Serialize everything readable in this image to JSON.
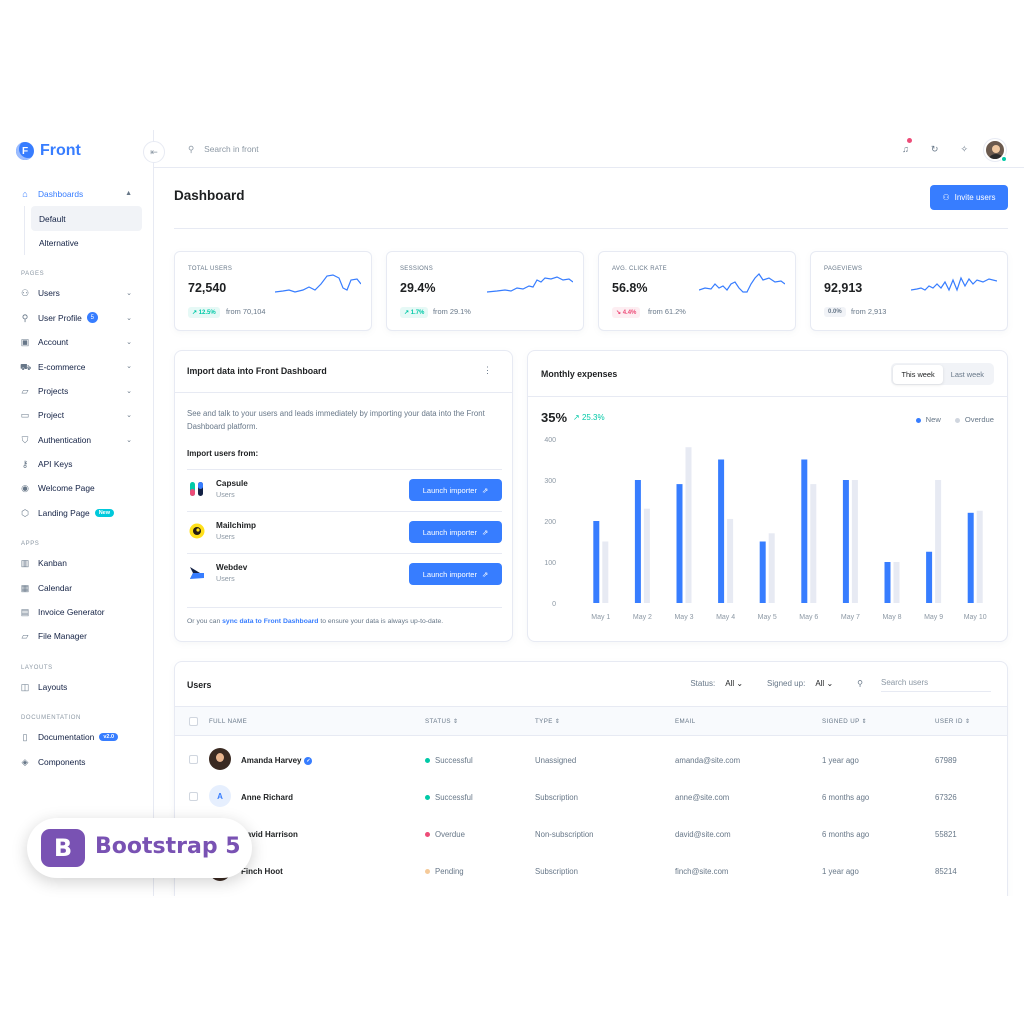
{
  "app": {
    "name": "Front",
    "logo_letter": "F",
    "brand_color": "#377dff"
  },
  "topbar": {
    "search_placeholder": "Search in front"
  },
  "sidebar": {
    "dashboards": {
      "label": "Dashboards",
      "children": [
        "Default",
        "Alternative"
      ]
    },
    "pages_heading": "PAGES",
    "pages": [
      {
        "label": "Users"
      },
      {
        "label": "User Profile",
        "badge": "5"
      },
      {
        "label": "Account"
      },
      {
        "label": "E-commerce"
      },
      {
        "label": "Projects"
      },
      {
        "label": "Project"
      },
      {
        "label": "Authentication"
      },
      {
        "label": "API Keys"
      },
      {
        "label": "Welcome Page"
      },
      {
        "label": "Landing Page",
        "badge": "New"
      }
    ],
    "apps_heading": "APPS",
    "apps": [
      "Kanban",
      "Calendar",
      "Invoice Generator",
      "File Manager"
    ],
    "layouts_heading": "LAYOUTS",
    "layouts": [
      "Layouts"
    ],
    "docs_heading": "DOCUMENTATION",
    "docs": [
      {
        "label": "Documentation",
        "badge": "v2.0"
      },
      {
        "label": "Components"
      }
    ]
  },
  "page": {
    "title": "Dashboard",
    "invite_label": "Invite users"
  },
  "stats": [
    {
      "label": "TOTAL USERS",
      "value": "72,540",
      "change": "12.5%",
      "trend": "up",
      "from": "from 70,104"
    },
    {
      "label": "SESSIONS",
      "value": "29.4%",
      "change": "1.7%",
      "trend": "up",
      "from": "from 29.1%"
    },
    {
      "label": "AVG. CLICK RATE",
      "value": "56.8%",
      "change": "4.4%",
      "trend": "down",
      "from": "from 61.2%"
    },
    {
      "label": "PAGEVIEWS",
      "value": "92,913",
      "change": "0.0%",
      "trend": "flat",
      "from": "from 2,913"
    }
  ],
  "import_card": {
    "title": "Import data into Front Dashboard",
    "description": "See and talk to your users and leads immediately by importing your data into the Front Dashboard platform.",
    "from_heading": "Import users from:",
    "button_label": "Launch importer",
    "sources": [
      {
        "name": "Capsule",
        "sub": "Users"
      },
      {
        "name": "Mailchimp",
        "sub": "Users"
      },
      {
        "name": "Webdev",
        "sub": "Users"
      }
    ],
    "footer_pre": "Or you can ",
    "footer_link": "sync data to Front Dashboard",
    "footer_post": " to ensure your data is always up-to-date."
  },
  "expenses": {
    "title": "Monthly expenses",
    "tab_this": "This week",
    "tab_last": "Last week",
    "big_value": "35%",
    "growth": "25.3%"
  },
  "chart_data": {
    "type": "bar",
    "categories": [
      "May 1",
      "May 2",
      "May 3",
      "May 4",
      "May 5",
      "May 6",
      "May 7",
      "May 8",
      "May 9",
      "May 10"
    ],
    "series": [
      {
        "name": "New",
        "color": "#377dff",
        "values": [
          200,
          300,
          290,
          350,
          150,
          350,
          300,
          100,
          125,
          220
        ]
      },
      {
        "name": "Overdue",
        "color": "#e7eaf3",
        "values": [
          150,
          230,
          380,
          205,
          170,
          290,
          300,
          100,
          300,
          225
        ]
      }
    ],
    "ylim": [
      0,
      400
    ],
    "yticks": [
      "400",
      "300",
      "200",
      "100",
      "0"
    ],
    "grid": false,
    "legend_position": "top-right"
  },
  "users_table": {
    "title": "Users",
    "status_label": "Status:",
    "status_value": "All",
    "signed_label": "Signed up:",
    "signed_value": "All",
    "search_placeholder": "Search users",
    "columns": [
      "FULL NAME",
      "STATUS",
      "TYPE",
      "EMAIL",
      "SIGNED UP",
      "USER ID"
    ],
    "rows": [
      {
        "name": "Amanda Harvey",
        "initial": "",
        "verified": true,
        "status": "Successful",
        "status_color": "#00c9a7",
        "type": "Unassigned",
        "email": "amanda@site.com",
        "signed": "1 year ago",
        "id": "67989"
      },
      {
        "name": "Anne Richard",
        "initial": "A",
        "verified": false,
        "status": "Successful",
        "status_color": "#00c9a7",
        "type": "Subscription",
        "email": "anne@site.com",
        "signed": "6 months ago",
        "id": "67326"
      },
      {
        "name": "David Harrison",
        "initial": "",
        "verified": false,
        "status": "Overdue",
        "status_color": "#ed4c78",
        "type": "Non-subscription",
        "email": "david@site.com",
        "signed": "6 months ago",
        "id": "55821"
      },
      {
        "name": "Finch Hoot",
        "initial": "",
        "verified": false,
        "status": "Pending",
        "status_color": "#f5ca99",
        "type": "Subscription",
        "email": "finch@site.com",
        "signed": "1 year ago",
        "id": "85214"
      }
    ]
  },
  "overlay_badge": {
    "logo": "B",
    "text": "Bootstrap 5",
    "color": "#7952b3"
  }
}
